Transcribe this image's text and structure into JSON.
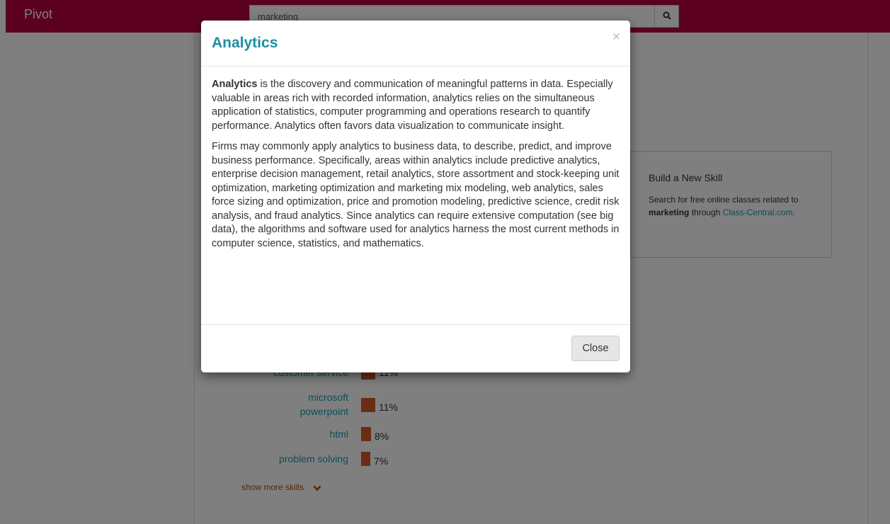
{
  "app": {
    "brand": "Pivot"
  },
  "search": {
    "value": "marketing",
    "button_icon": "search-icon"
  },
  "panel": {
    "title": "Build a New Skill",
    "text_before": "Search for free online classes related to ",
    "keyword": "marketing",
    "text_middle": " through ",
    "link": "Class-Central.com",
    "text_after": "."
  },
  "skills": [
    {
      "name": "customer service",
      "pct": "11%",
      "value": 11
    },
    {
      "name": "microsoft powerpoint",
      "pct": "11%",
      "value": 11
    },
    {
      "name": "html",
      "pct": "8%",
      "value": 8
    },
    {
      "name": "problem solving",
      "pct": "7%",
      "value": 7
    }
  ],
  "show_more": "show more skills",
  "modal": {
    "title": "Analytics",
    "close_symbol": "×",
    "p1_bold": "Analytics",
    "p1_rest": " is the discovery and communication of meaningful patterns in data. Especially valuable in areas rich with recorded information, analytics relies on the simultaneous application of statistics, computer programming and operations research to quantify performance. Analytics often favors data visualization to communicate insight.",
    "p2": "Firms may commonly apply analytics to business data, to describe, predict, and improve business performance. Specifically, areas within analytics include predictive analytics, enterprise decision management, retail analytics, store assortment and stock-keeping unit optimization, marketing optimization and marketing mix modeling, web analytics, sales force sizing and optimization, price and promotion modeling, predictive science, credit risk analysis, and fraud analytics. Since analytics can require extensive computation (see big data), the algorithms and software used for analytics harness the most current methods in computer science, statistics, and mathematics.",
    "close_label": "Close"
  }
}
